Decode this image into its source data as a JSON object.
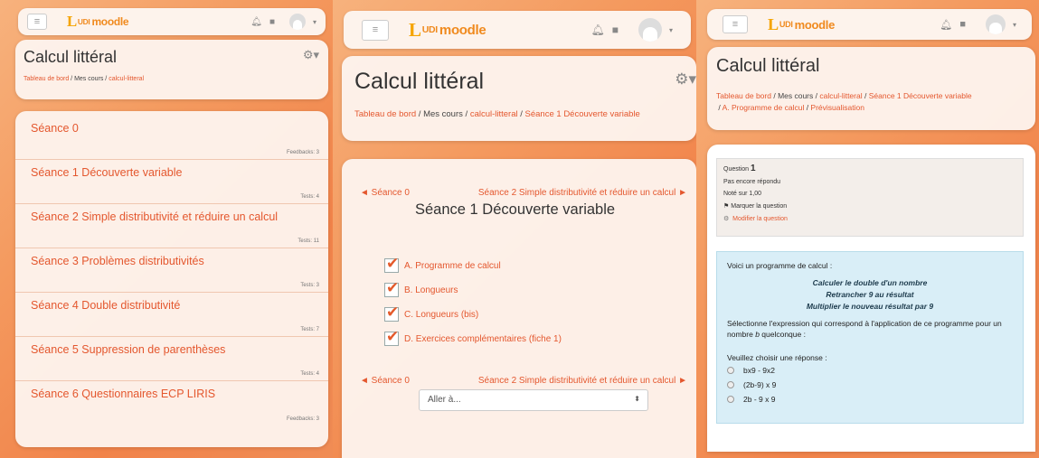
{
  "colors": {
    "accent": "#e4572e",
    "logo_l": "#f5a400",
    "logo_text": "#f08a1e",
    "question_bg": "#d9eef7"
  },
  "brand": {
    "l": "L",
    "udi": "UDI",
    "moodle": "moodle"
  },
  "nav_icons": [
    "hamburger-icon",
    "bell-icon",
    "chat-icon",
    "user-avatar-icon",
    "caret-down-icon"
  ],
  "panel1": {
    "title": "Calcul littéral",
    "breadcrumb": [
      "Tableau de bord",
      "Mes cours",
      "calcul-litteral"
    ],
    "sections": [
      {
        "name": "Séance 0",
        "meta": "Feedbacks: 3"
      },
      {
        "name": "Séance 1 Découverte variable",
        "meta": "Tests: 4"
      },
      {
        "name": "Séance 2 Simple distributivité et réduire un calcul",
        "meta": "Tests: 11"
      },
      {
        "name": "Séance 3 Problèmes distributivités",
        "meta": "Tests: 3"
      },
      {
        "name": "Séance 4 Double distributivité",
        "meta": "Tests: 7"
      },
      {
        "name": "Séance 5 Suppression de parenthèses",
        "meta": "Tests: 4"
      },
      {
        "name": "Séance 6 Questionnaires ECP LIRIS",
        "meta": "Feedbacks: 3"
      }
    ]
  },
  "panel2": {
    "title": "Calcul littéral",
    "breadcrumb": [
      "Tableau de bord",
      "Mes cours",
      "calcul-litteral",
      "Séance 1 Découverte variable"
    ],
    "prev": "◄ Séance 0",
    "next": "Séance 2 Simple distributivité et réduire un calcul ►",
    "heading": "Séance 1 Découverte variable",
    "activities": [
      "A. Programme de calcul",
      "B. Longueurs",
      "C. Longueurs (bis)",
      "D. Exercices complémentaires (fiche 1)"
    ],
    "jump_select": "Aller à..."
  },
  "panel3": {
    "title": "Calcul littéral",
    "breadcrumb": [
      "Tableau de bord",
      "Mes cours",
      "calcul-litteral",
      "Séance 1 Découverte variable",
      "A. Programme de calcul",
      "Prévisualisation"
    ],
    "question": {
      "label": "Question",
      "number": "1",
      "status": "Pas encore répondu",
      "grade": "Noté sur 1,00",
      "flag": "Marquer la question",
      "edit": "Modifier la question"
    },
    "intro": "Voici un programme de calcul :",
    "program": [
      "Calculer le double d'un nombre",
      "Retrancher 9 au résultat",
      "Multiplier le nouveau résultat par 9"
    ],
    "prompt_a": "Sélectionne l'expression qui correspond à l'application de ce programme pour un nombre ",
    "prompt_var": "b",
    "prompt_b": " quelconque :",
    "choose": "Veuillez choisir une réponse :",
    "options": [
      "bx9 - 9x2",
      "(2b-9) x 9",
      "2b - 9 x 9"
    ]
  }
}
